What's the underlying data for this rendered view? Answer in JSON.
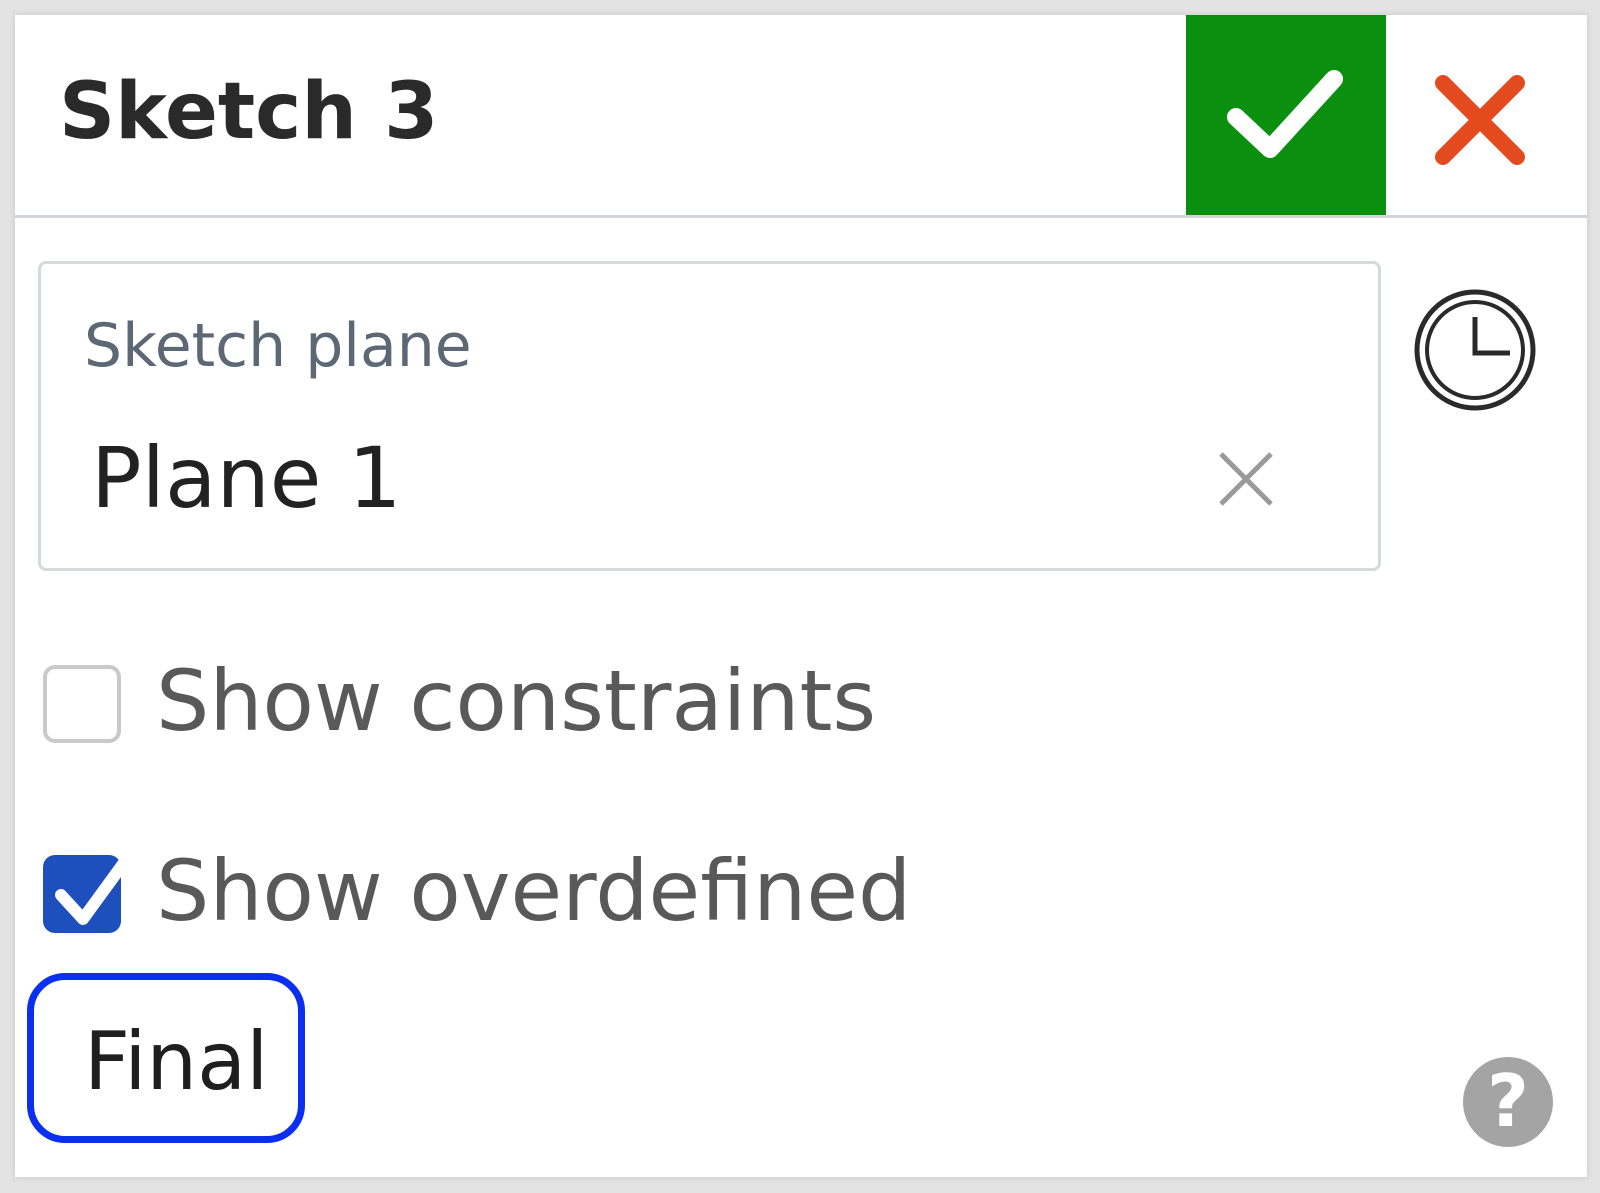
{
  "dialog": {
    "title": "Sketch 3",
    "accept_icon": "checkmark-icon",
    "cancel_icon": "close-icon",
    "accent_color": "#0a8f0e",
    "cancel_color": "#e34b1e"
  },
  "sketch_plane": {
    "label": "Sketch plane",
    "value": "Plane 1",
    "clear_icon": "clear-icon",
    "history_icon": "history-icon"
  },
  "options": [
    {
      "label": "Show constraints",
      "checked": false
    },
    {
      "label": "Show overdefined",
      "checked": true
    }
  ],
  "footer": {
    "final_label": "Final",
    "help_label": "?",
    "help_icon": "help-icon"
  }
}
